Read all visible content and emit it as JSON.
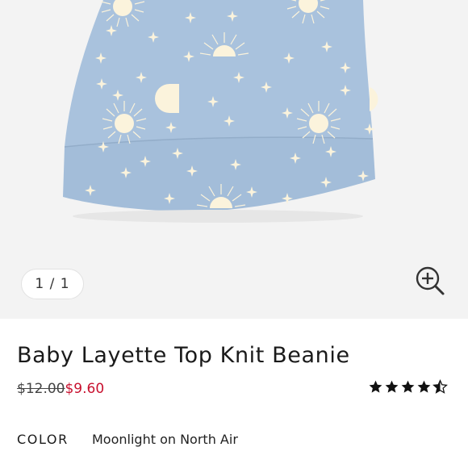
{
  "gallery": {
    "counter": "1 / 1",
    "image_name": "beanie-product-image",
    "zoom_icon": "zoom-in-icon"
  },
  "product": {
    "title": "Baby Layette Top Knit Beanie",
    "old_price": "$12.00",
    "sale_price": "$9.60",
    "rating": 4.5,
    "rating_max": 5
  },
  "color": {
    "label": "COLOR",
    "value": "Moonlight on North Air"
  },
  "colors": {
    "gallery_bg": "#f3f3f3",
    "beanie": "#a9c2dd",
    "pattern": "#fbf3dc",
    "sale": "#c8102e"
  }
}
